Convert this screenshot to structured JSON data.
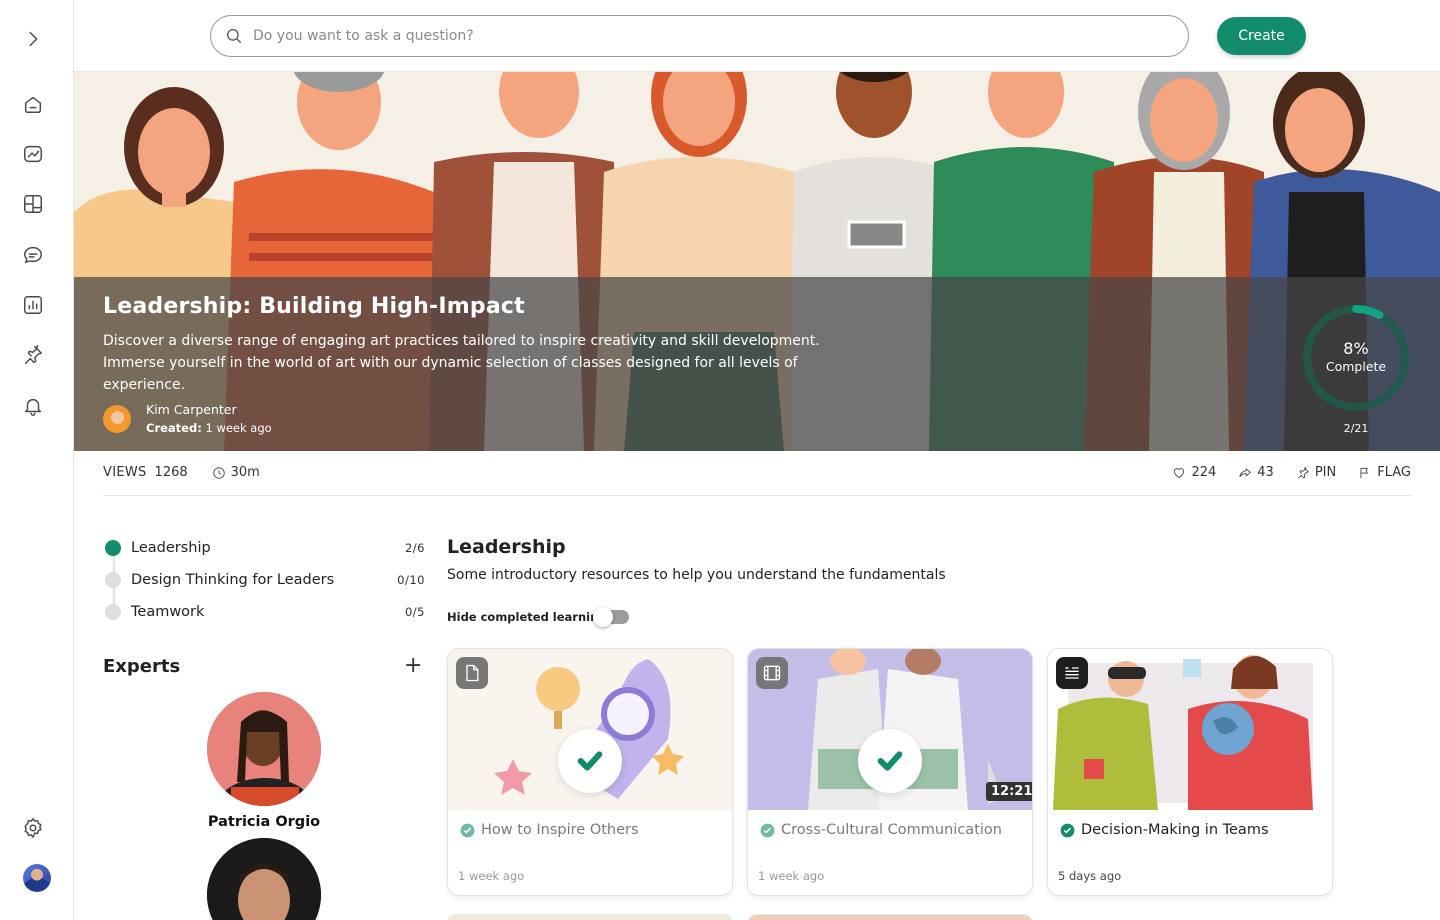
{
  "search": {
    "placeholder": "Do you want to ask a question?"
  },
  "header": {
    "create_label": "Create"
  },
  "sidebar": {
    "items": [
      {
        "icon": "chevron-right-icon"
      },
      {
        "icon": "home-icon"
      },
      {
        "icon": "trending-chart-icon"
      },
      {
        "icon": "dashboard-grid-icon"
      },
      {
        "icon": "chat-icon"
      },
      {
        "icon": "analytics-icon"
      },
      {
        "icon": "pin-icon"
      },
      {
        "icon": "bell-icon"
      },
      {
        "icon": "gear-icon"
      }
    ]
  },
  "course": {
    "title": "Leadership: Building High-Impact",
    "description": "Discover a diverse range of engaging art practices tailored to inspire creativity and skill development. Immerse yourself in the world of art with our dynamic selection of classes designed for all levels of experience.",
    "author": "Kim Carpenter",
    "created_label": "Created:",
    "created_value": "1 week ago",
    "progress_percent": 8,
    "progress_text": "8%",
    "progress_label": "Complete",
    "progress_count": "2/21"
  },
  "stats": {
    "views_label": "VIEWS",
    "views": "1268",
    "duration": "30m",
    "likes": "224",
    "shares": "43",
    "pin_label": "PIN",
    "flag_label": "FLAG"
  },
  "modules": [
    {
      "name": "Leadership",
      "count": "2/6",
      "active": true
    },
    {
      "name": "Design Thinking for Leaders",
      "count": "0/10",
      "active": false
    },
    {
      "name": "Teamwork",
      "count": "0/5",
      "active": false
    }
  ],
  "experts": {
    "title": "Experts",
    "add_label": "+",
    "names": [
      "Patricia Orgio"
    ]
  },
  "section": {
    "title": "Leadership",
    "description": "Some introductory resources to help you understand the fundamentals",
    "hide_completed_label": "Hide completed learning",
    "hide_completed": false
  },
  "cards": [
    {
      "title": "How to Inspire Others",
      "date": "1 week ago",
      "type": "document-icon",
      "completed": true
    },
    {
      "title": "Cross-Cultural Communication",
      "date": "1 week ago",
      "type": "video-icon",
      "completed": true,
      "duration": "12:21"
    },
    {
      "title": "Decision-Making in Teams",
      "date": "5 days ago",
      "type": "quote-list-icon",
      "completed": false
    }
  ],
  "colors": {
    "accent": "#138c6e"
  }
}
